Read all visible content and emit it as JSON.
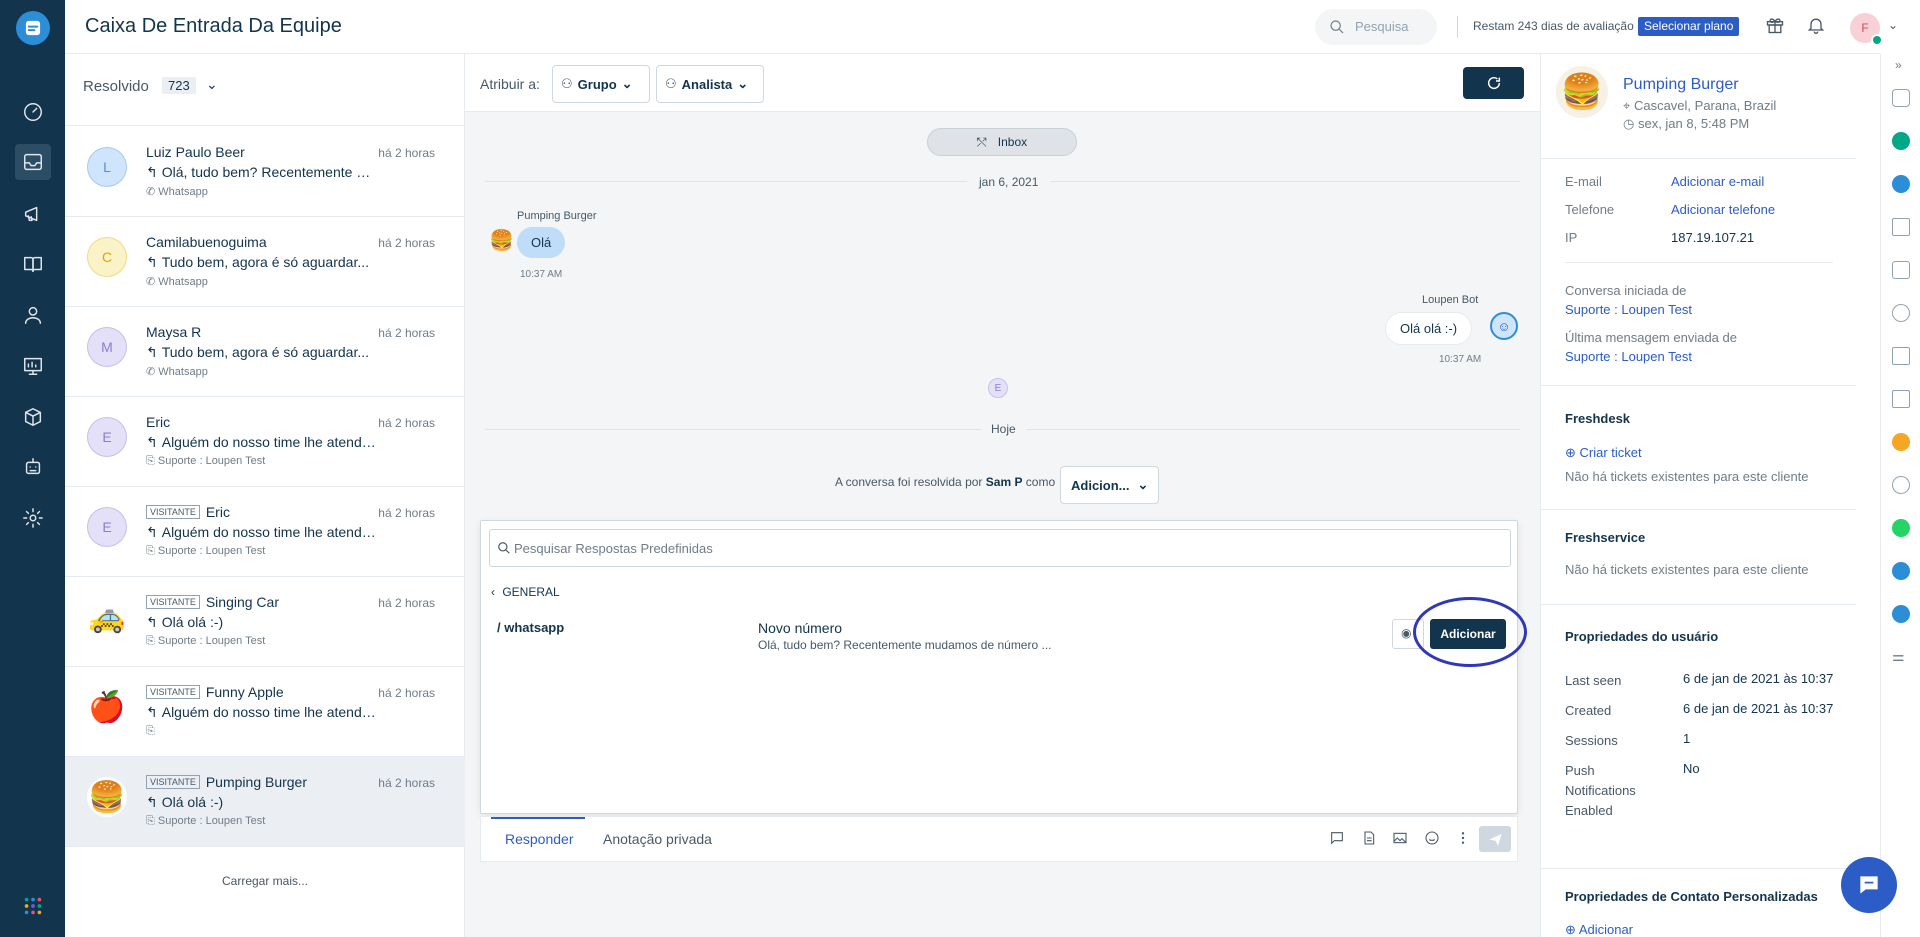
{
  "header": {
    "title": "Caixa De Entrada Da Equipe",
    "search_placeholder": "Pesquisa",
    "trial_text": "Restam 243 dias de avaliação",
    "plan_button": "Selecionar plano",
    "avatar_initial": "F"
  },
  "nav": {
    "icons": [
      "logo-icon",
      "dashboard-icon",
      "inbox-icon",
      "campaigns-icon",
      "knowledge-base-icon",
      "contacts-icon",
      "reports-icon",
      "apps-icon",
      "bot-icon",
      "settings-icon",
      "app-switcher-icon"
    ]
  },
  "list": {
    "filter_label": "Resolvido",
    "filter_count": "723",
    "conversations": [
      {
        "name": "Luiz Paulo Beer",
        "badge": "",
        "initial": "L",
        "time": "há 2 horas",
        "message": "Olá, tudo bem? Recentemente mudamos...",
        "channel": "Whatsapp",
        "avatar_bg": "#cfe5fb",
        "avatar_fg": "#5b8fd6"
      },
      {
        "name": "Camilabuenoguima",
        "badge": "",
        "initial": "C",
        "time": "há 2 horas",
        "message": "Tudo bem, agora é só aguardar...",
        "channel": "Whatsapp",
        "avatar_bg": "#fbf3c8",
        "avatar_fg": "#d8a900"
      },
      {
        "name": "Maysa R",
        "badge": "",
        "initial": "M",
        "time": "há 2 horas",
        "message": "Tudo bem, agora é só aguardar...",
        "channel": "Whatsapp",
        "avatar_bg": "#e4e0f7",
        "avatar_fg": "#8b7fd3"
      },
      {
        "name": "Eric",
        "badge": "",
        "initial": "E",
        "time": "há 2 horas",
        "message": "Alguém do nosso time lhe atenderá...",
        "channel": "Suporte : Loupen Test",
        "avatar_bg": "#e4e0f7",
        "avatar_fg": "#8b7fd3"
      },
      {
        "name": "Eric",
        "badge": "VISITANTE",
        "initial": "E",
        "time": "há 2 horas",
        "message": "Alguém do nosso time lhe atenderá...",
        "channel": "Suporte : Loupen Test",
        "avatar_bg": "#e4e0f7",
        "avatar_fg": "#8b7fd3"
      },
      {
        "name": "Singing Car",
        "badge": "VISITANTE",
        "initial": "🚕",
        "time": "há 2 horas",
        "message": "Olá olá :-)",
        "channel": "Suporte : Loupen Test",
        "avatar_bg": "#ffffff",
        "avatar_fg": "#000000"
      },
      {
        "name": "Funny Apple",
        "badge": "VISITANTE",
        "initial": "🍎",
        "time": "há 2 horas",
        "message": "Alguém do nosso time lhe atenderá...",
        "channel": "",
        "avatar_bg": "#ffffff",
        "avatar_fg": "#000000"
      },
      {
        "name": "Pumping Burger",
        "badge": "VISITANTE",
        "initial": "🍔",
        "time": "há 2 horas",
        "message": "Olá olá :-)",
        "channel": "Suporte : Loupen Test",
        "avatar_bg": "#ffffff",
        "avatar_fg": "#000000"
      }
    ],
    "load_more": "Carregar mais..."
  },
  "chat": {
    "assign_label": "Atribuir a:",
    "group_label": "Grupo",
    "agent_label": "Analista",
    "inbox_label": "Inbox",
    "date1": "jan 6, 2021",
    "customer_name": "Pumping Burger",
    "customer_msg": "Olá",
    "customer_time": "10:37 AM",
    "bot_name": "Loupen Bot",
    "bot_msg": "Olá olá :-)",
    "bot_time": "10:37 AM",
    "system_initial": "E",
    "date2": "Hoje",
    "resolved_prefix": "A conversa foi resolvida por",
    "resolved_by": "Sam P",
    "resolved_as": "como",
    "resolved_status": "Adicion..."
  },
  "canned": {
    "search_placeholder": "Pesquisar Respostas Predefinidas",
    "back_label": "GENERAL",
    "key": "/ whatsapp",
    "title": "Novo número",
    "preview": "Olá, tudo bem? Recentemente mudamos de número ...",
    "add_label": "Adicionar"
  },
  "reply": {
    "tab_reply": "Responder",
    "tab_note": "Anotação privada"
  },
  "contact": {
    "name": "Pumping Burger",
    "location": "Cascavel, Parana, Brazil",
    "local_time": "sex, jan 8, 5:48 PM",
    "email_label": "E-mail",
    "email_value": "Adicionar e-mail",
    "phone_label": "Telefone",
    "phone_value": "Adicionar telefone",
    "ip_label": "IP",
    "ip_value": "187.19.107.21",
    "started_label": "Conversa iniciada de",
    "started_value": "Suporte : Loupen Test",
    "last_label": "Última mensagem enviada de",
    "last_value": "Suporte : Loupen Test",
    "freshdesk_title": "Freshdesk",
    "freshdesk_create": "Criar ticket",
    "freshdesk_empty": "Não há tickets existentes para este cliente",
    "freshservice_title": "Freshservice",
    "freshservice_empty": "Não há tickets existentes para este cliente",
    "props_title": "Propriedades do usuário",
    "props": [
      {
        "k": "Last seen",
        "v": "6 de jan de 2021 às 10:37"
      },
      {
        "k": "Created",
        "v": "6 de jan de 2021 às 10:37"
      },
      {
        "k": "Sessions",
        "v": "1"
      },
      {
        "k": "Push Notifications Enabled",
        "v": "No"
      }
    ],
    "custom_title": "Propriedades de Contato Personalizadas",
    "custom_add": "Adicionar"
  },
  "colors": {
    "nav_bg": "#12344d",
    "accent": "#2c5cc5",
    "highlight": "#3037b8"
  }
}
